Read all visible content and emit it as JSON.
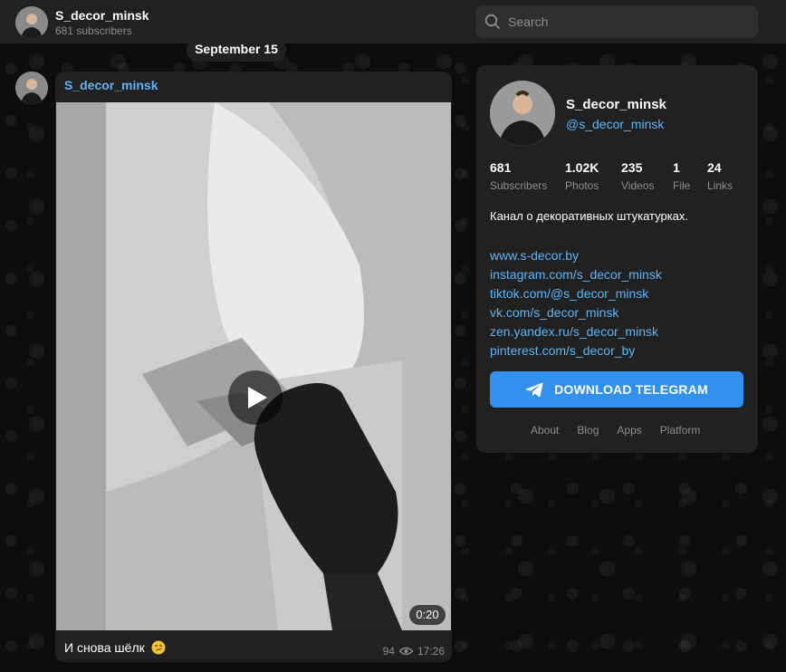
{
  "header": {
    "title": "S_decor_minsk",
    "subtitle": "681 subscribers"
  },
  "search": {
    "placeholder": "Search"
  },
  "date_pill": "September 15",
  "post": {
    "author": "S_decor_minsk",
    "duration": "0:20",
    "caption": "И снова шёлк",
    "views": "94",
    "time": "17:26"
  },
  "card": {
    "title": "S_decor_minsk",
    "handle": "@s_decor_minsk",
    "stats": [
      {
        "value": "681",
        "label": "Subscribers"
      },
      {
        "value": "1.02K",
        "label": "Photos"
      },
      {
        "value": "235",
        "label": "Videos"
      },
      {
        "value": "1",
        "label": "File"
      },
      {
        "value": "24",
        "label": "Links"
      }
    ],
    "description": "Канал о декоративных штукатурках.",
    "links": [
      "www.s-decor.by",
      "instagram.com/s_decor_minsk",
      "tiktok.com/@s_decor_minsk",
      "vk.com/s_decor_minsk",
      "zen.yandex.ru/s_decor_minsk",
      "pinterest.com/s_decor_by"
    ],
    "download_label": "DOWNLOAD TELEGRAM",
    "footer": [
      "About",
      "Blog",
      "Apps",
      "Platform"
    ]
  },
  "colors": {
    "accent": "#3390ec",
    "link": "#5eb5f7",
    "panel": "#212121"
  }
}
